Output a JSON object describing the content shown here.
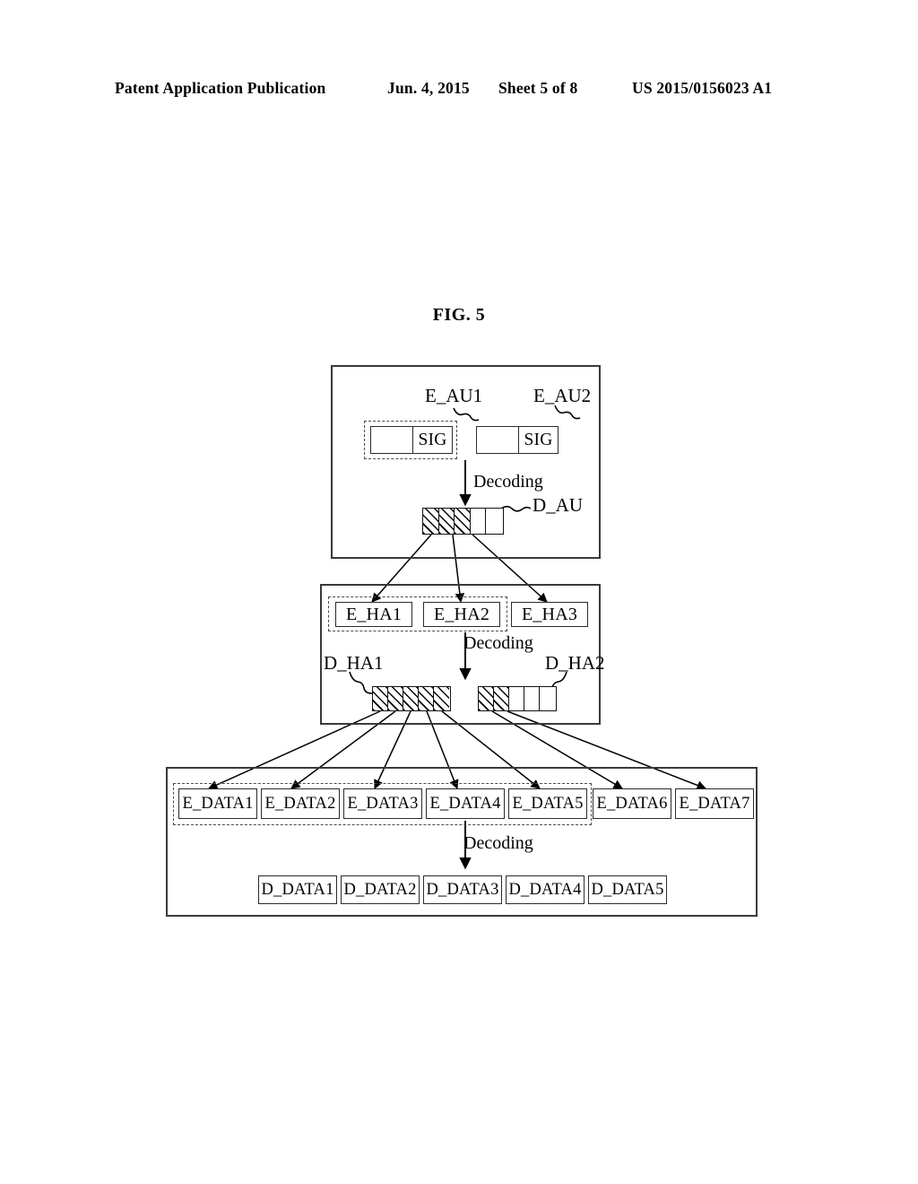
{
  "header": {
    "publication": "Patent Application Publication",
    "date": "Jun. 4, 2015",
    "sheet": "Sheet 5 of 8",
    "number": "US 2015/0156023 A1"
  },
  "figure": {
    "title": "FIG. 5",
    "decoding_label": "Decoding"
  },
  "au_panel": {
    "labels": {
      "au1": "E_AU1",
      "au2": "E_AU2",
      "decoded": "D_AU"
    },
    "au_boxes": [
      {
        "name": "E_AU1",
        "cells": [
          "",
          "SIG"
        ],
        "selected": true
      },
      {
        "name": "E_AU2",
        "cells": [
          "",
          "SIG"
        ],
        "selected": false
      }
    ],
    "decoded_bar": {
      "name": "D_AU",
      "cells": [
        "hatched",
        "hatched",
        "hatched",
        "empty",
        "empty"
      ]
    },
    "decoding": "Decoding"
  },
  "ha_panel": {
    "encoded": [
      {
        "label": "E_HA1",
        "selected": true
      },
      {
        "label": "E_HA2",
        "selected": true
      },
      {
        "label": "E_HA3",
        "selected": false
      }
    ],
    "decoding": "Decoding",
    "decoded": [
      {
        "label": "D_HA1",
        "cells": [
          "hatched",
          "hatched",
          "hatched",
          "hatched",
          "hatched"
        ]
      },
      {
        "label": "D_HA2",
        "cells": [
          "hatched",
          "hatched",
          "empty",
          "empty",
          "empty"
        ]
      }
    ]
  },
  "data_panel": {
    "encoded": [
      {
        "label": "E_DATA1",
        "selected": true
      },
      {
        "label": "E_DATA2",
        "selected": true
      },
      {
        "label": "E_DATA3",
        "selected": true
      },
      {
        "label": "E_DATA4",
        "selected": true
      },
      {
        "label": "E_DATA5",
        "selected": true
      },
      {
        "label": "E_DATA6",
        "selected": false
      },
      {
        "label": "E_DATA7",
        "selected": false
      }
    ],
    "decoding": "Decoding",
    "decoded": [
      {
        "label": "D_DATA1"
      },
      {
        "label": "D_DATA2"
      },
      {
        "label": "D_DATA3"
      },
      {
        "label": "D_DATA4"
      },
      {
        "label": "D_DATA5"
      }
    ]
  },
  "colors": {
    "ink": "#000000",
    "panel_border": "#3a3a3a",
    "dashed_selection": "#4a4a4a"
  }
}
